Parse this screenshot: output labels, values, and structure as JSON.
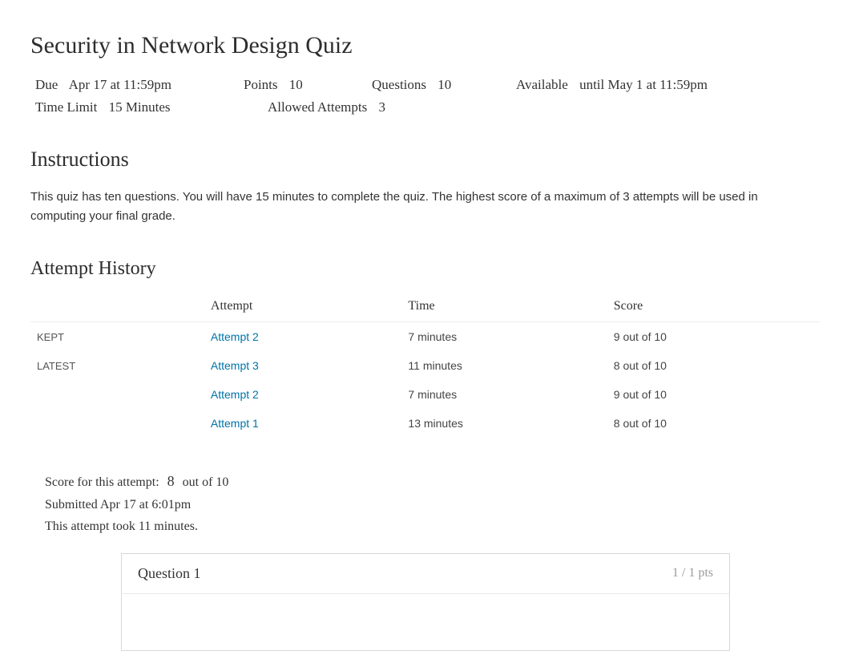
{
  "page": {
    "title": "Security in Network Design Quiz"
  },
  "meta": {
    "due_label": "Due",
    "due_value": "Apr 17 at 11:59pm",
    "points_label": "Points",
    "points_value": "10",
    "questions_label": "Questions",
    "questions_value": "10",
    "available_label": "Available",
    "available_value": "until May 1 at 11:59pm",
    "time_limit_label": "Time Limit",
    "time_limit_value": "15 Minutes",
    "allowed_attempts_label": "Allowed Attempts",
    "allowed_attempts_value": "3"
  },
  "instructions": {
    "heading": "Instructions",
    "body": "This quiz has ten questions. You will have 15 minutes to complete the quiz. The highest score of a maximum of 3 attempts will be used in computing your final grade."
  },
  "attempt_history": {
    "heading": "Attempt History",
    "columns": {
      "status": "",
      "attempt": "Attempt",
      "time": "Time",
      "score": "Score"
    },
    "rows": [
      {
        "status": "KEPT",
        "attempt": "Attempt 2",
        "time": "7 minutes",
        "score": "9 out of 10"
      },
      {
        "status": "LATEST",
        "attempt": "Attempt 3",
        "time": "11 minutes",
        "score": "8 out of 10"
      },
      {
        "status": "",
        "attempt": "Attempt 2",
        "time": "7 minutes",
        "score": "9 out of 10"
      },
      {
        "status": "",
        "attempt": "Attempt 1",
        "time": "13 minutes",
        "score": "8 out of 10"
      }
    ]
  },
  "score_summary": {
    "label": "Score for this attempt:",
    "score": "8",
    "suffix": "out of 10",
    "submitted": "Submitted Apr 17 at 6:01pm",
    "duration": "This attempt took 11 minutes."
  },
  "question": {
    "title": "Question 1",
    "points": "1 / 1 pts"
  }
}
